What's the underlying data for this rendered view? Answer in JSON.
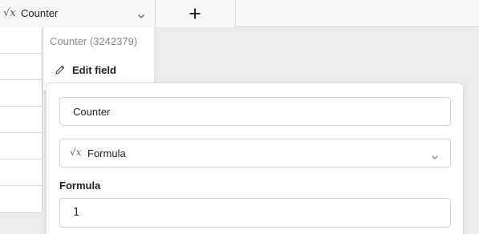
{
  "field_header": {
    "type_icon": "formula-icon",
    "name": "Counter",
    "chevron_icon": "chevron-down-icon"
  },
  "add_column": {
    "icon": "plus-icon"
  },
  "context_menu": {
    "title": "Counter (3242379)",
    "edit_label": "Edit field",
    "edit_icon": "pencil-icon"
  },
  "edit_panel": {
    "name_value": "Counter",
    "type_icon": "formula-icon",
    "type_label": "Formula",
    "formula_label": "Formula",
    "formula_value": "1"
  },
  "colors": {
    "background": "#ececec",
    "header_background": "#f7f7f7",
    "border": "#d3d3d3",
    "muted_text": "#8a8a8a"
  }
}
